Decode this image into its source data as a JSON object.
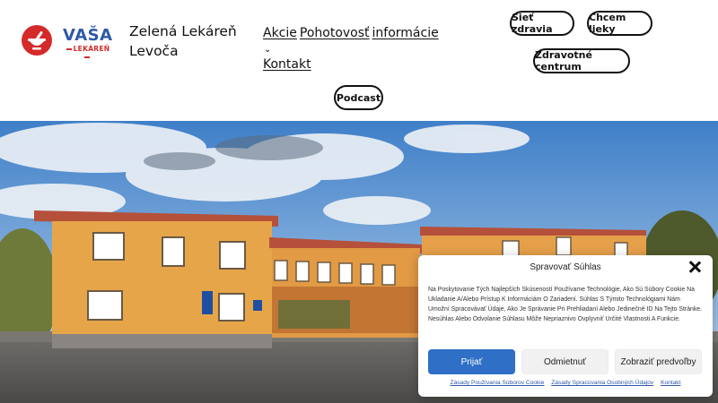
{
  "brand": {
    "logo_word": "VAŠA",
    "logo_sub": "LEKÁREŇ",
    "title_line1": "Zelená Lekáreň",
    "title_line2": "Levoča",
    "colors": {
      "blue": "#2f5aa8",
      "red": "#d42a2a"
    }
  },
  "nav": {
    "items": [
      {
        "label": "Akcie"
      },
      {
        "label": "Pohotovosť"
      },
      {
        "label": "informácie"
      },
      {
        "label": "Kontakt"
      }
    ],
    "dropdown_icon": "chevron-down-icon"
  },
  "pills": {
    "siet_zdravia": "Sieť zdravia",
    "chcem_lieky": "Chcem lieky",
    "zdravotne_centrum": "Zdravotné centrum",
    "podcast": "Podcast"
  },
  "consent": {
    "title": "Spravovať Súhlas",
    "text": "Na Poskytovanie Tých Najlepších Skúseností Používame Technológie, Ako Sú Súbory Cookie Na Ukladanie A/Alebo Prístup K Informáciám O Zariadení. Súhlas S Týmito Technológiami Nám Umožní Spracovávať Údaje, Ako Je Správanie Pri Prehliadaní Alebo Jedinečné ID Na Tejto Stránke. Nesúhlas Alebo Odvolanie Súhlasu Môže Nepriaznivo Ovplyvniť Určité Vlastnosti A Funkcie.",
    "accept_label": "Prijať",
    "deny_label": "Odmietnuť",
    "prefs_label": "Zobraziť predvoľby",
    "links": [
      {
        "label": "Zásady Používania Súborov Cookie"
      },
      {
        "label": "Zásady Spracúvania Osobných Údajov"
      },
      {
        "label": "Kontakt"
      }
    ],
    "accent_color": "#2f6fc6"
  }
}
